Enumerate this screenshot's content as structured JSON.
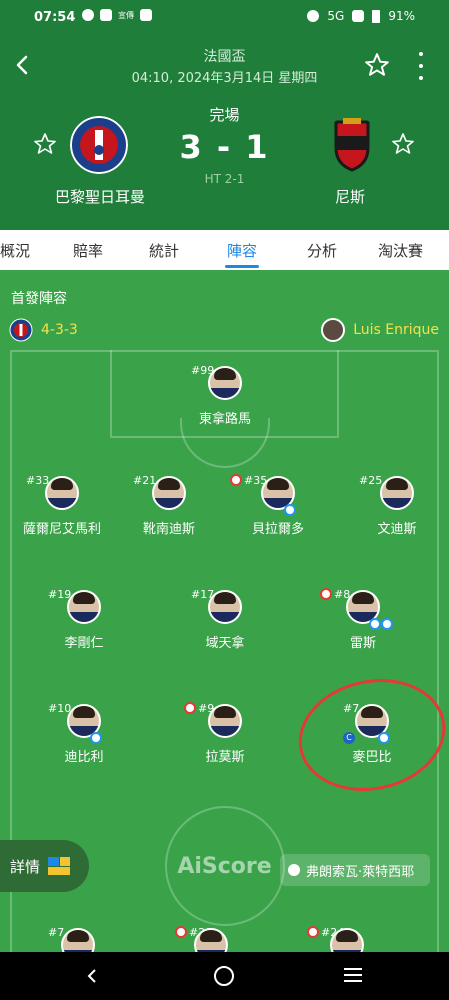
{
  "statusbar": {
    "time": "07:54",
    "network": "5G",
    "battery": "91%",
    "tiny_label": "宣傳"
  },
  "header": {
    "competition": "法國盃",
    "kickoff": "04:10, 2024年3月14日 星期四",
    "status": "完場",
    "score": "3 - 1",
    "halftime": "HT 2-1",
    "home": {
      "name": "巴黎聖日耳曼",
      "crest_color": "#1c3f8c"
    },
    "away": {
      "name": "尼斯",
      "crest_color": "#c4161c"
    }
  },
  "tabs": [
    {
      "label": "概況"
    },
    {
      "label": "賠率"
    },
    {
      "label": "統計"
    },
    {
      "label": "陣容"
    },
    {
      "label": "分析"
    },
    {
      "label": "淘汰賽"
    }
  ],
  "lineup": {
    "title": "首發陣容",
    "formation": "4-3-3",
    "coach": "Luis Enrique",
    "watermark": "AiScore",
    "details_label": "詳情",
    "referee": "弗朗索瓦·萊特西耶",
    "players": {
      "gk": {
        "number": "#99",
        "name": "東拿路馬"
      },
      "d1": {
        "number": "#33",
        "name": "薩爾尼艾馬利"
      },
      "d2": {
        "number": "#21",
        "name": "靴南迪斯"
      },
      "d3": {
        "number": "#35",
        "name": "貝拉爾多"
      },
      "d4": {
        "number": "#25",
        "name": "文迪斯"
      },
      "m1": {
        "number": "#19",
        "name": "李剛仁"
      },
      "m2": {
        "number": "#17",
        "name": "域天拿"
      },
      "m3": {
        "number": "#8",
        "name": "雷斯"
      },
      "f1": {
        "number": "#10",
        "name": "迪比利"
      },
      "f2": {
        "number": "#9",
        "name": "拉莫斯"
      },
      "f3": {
        "number": "#7",
        "name": "麥巴比"
      },
      "b1": {
        "number": "#7"
      },
      "b2": {
        "number": "#29"
      },
      "b3": {
        "number": "#24"
      }
    }
  },
  "colors": {
    "header_green": "#1f7f3a",
    "pitch_green": "#3aa34a",
    "accent_blue": "#1e88e5",
    "formation_yellow": "#f4e04d",
    "highlight_red": "#e53935"
  }
}
